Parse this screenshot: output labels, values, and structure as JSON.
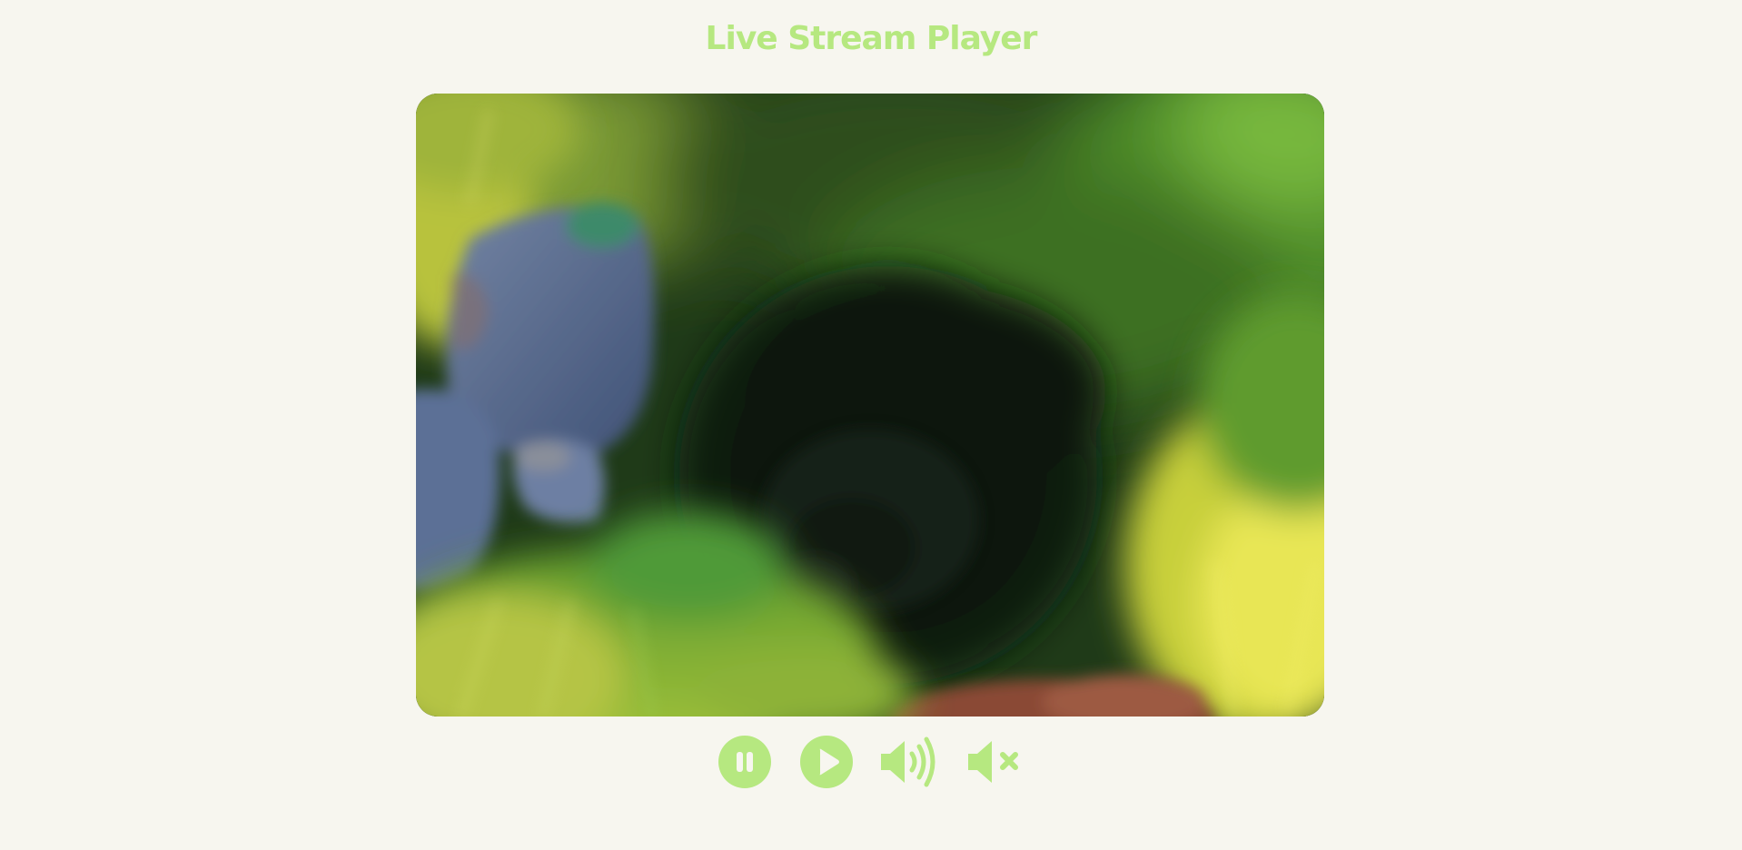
{
  "header": {
    "title": "Live Stream Player"
  },
  "colors": {
    "accent": "#b6e880",
    "background": "#f7f6ef"
  },
  "player": {
    "content": "video frame of a grassy cave entrance with blue boulders"
  },
  "controls": [
    {
      "name": "pause-button",
      "icon": "pause-icon"
    },
    {
      "name": "play-button",
      "icon": "play-icon"
    },
    {
      "name": "unmute-button",
      "icon": "volume-up-icon"
    },
    {
      "name": "mute-button",
      "icon": "volume-mute-icon"
    }
  ]
}
